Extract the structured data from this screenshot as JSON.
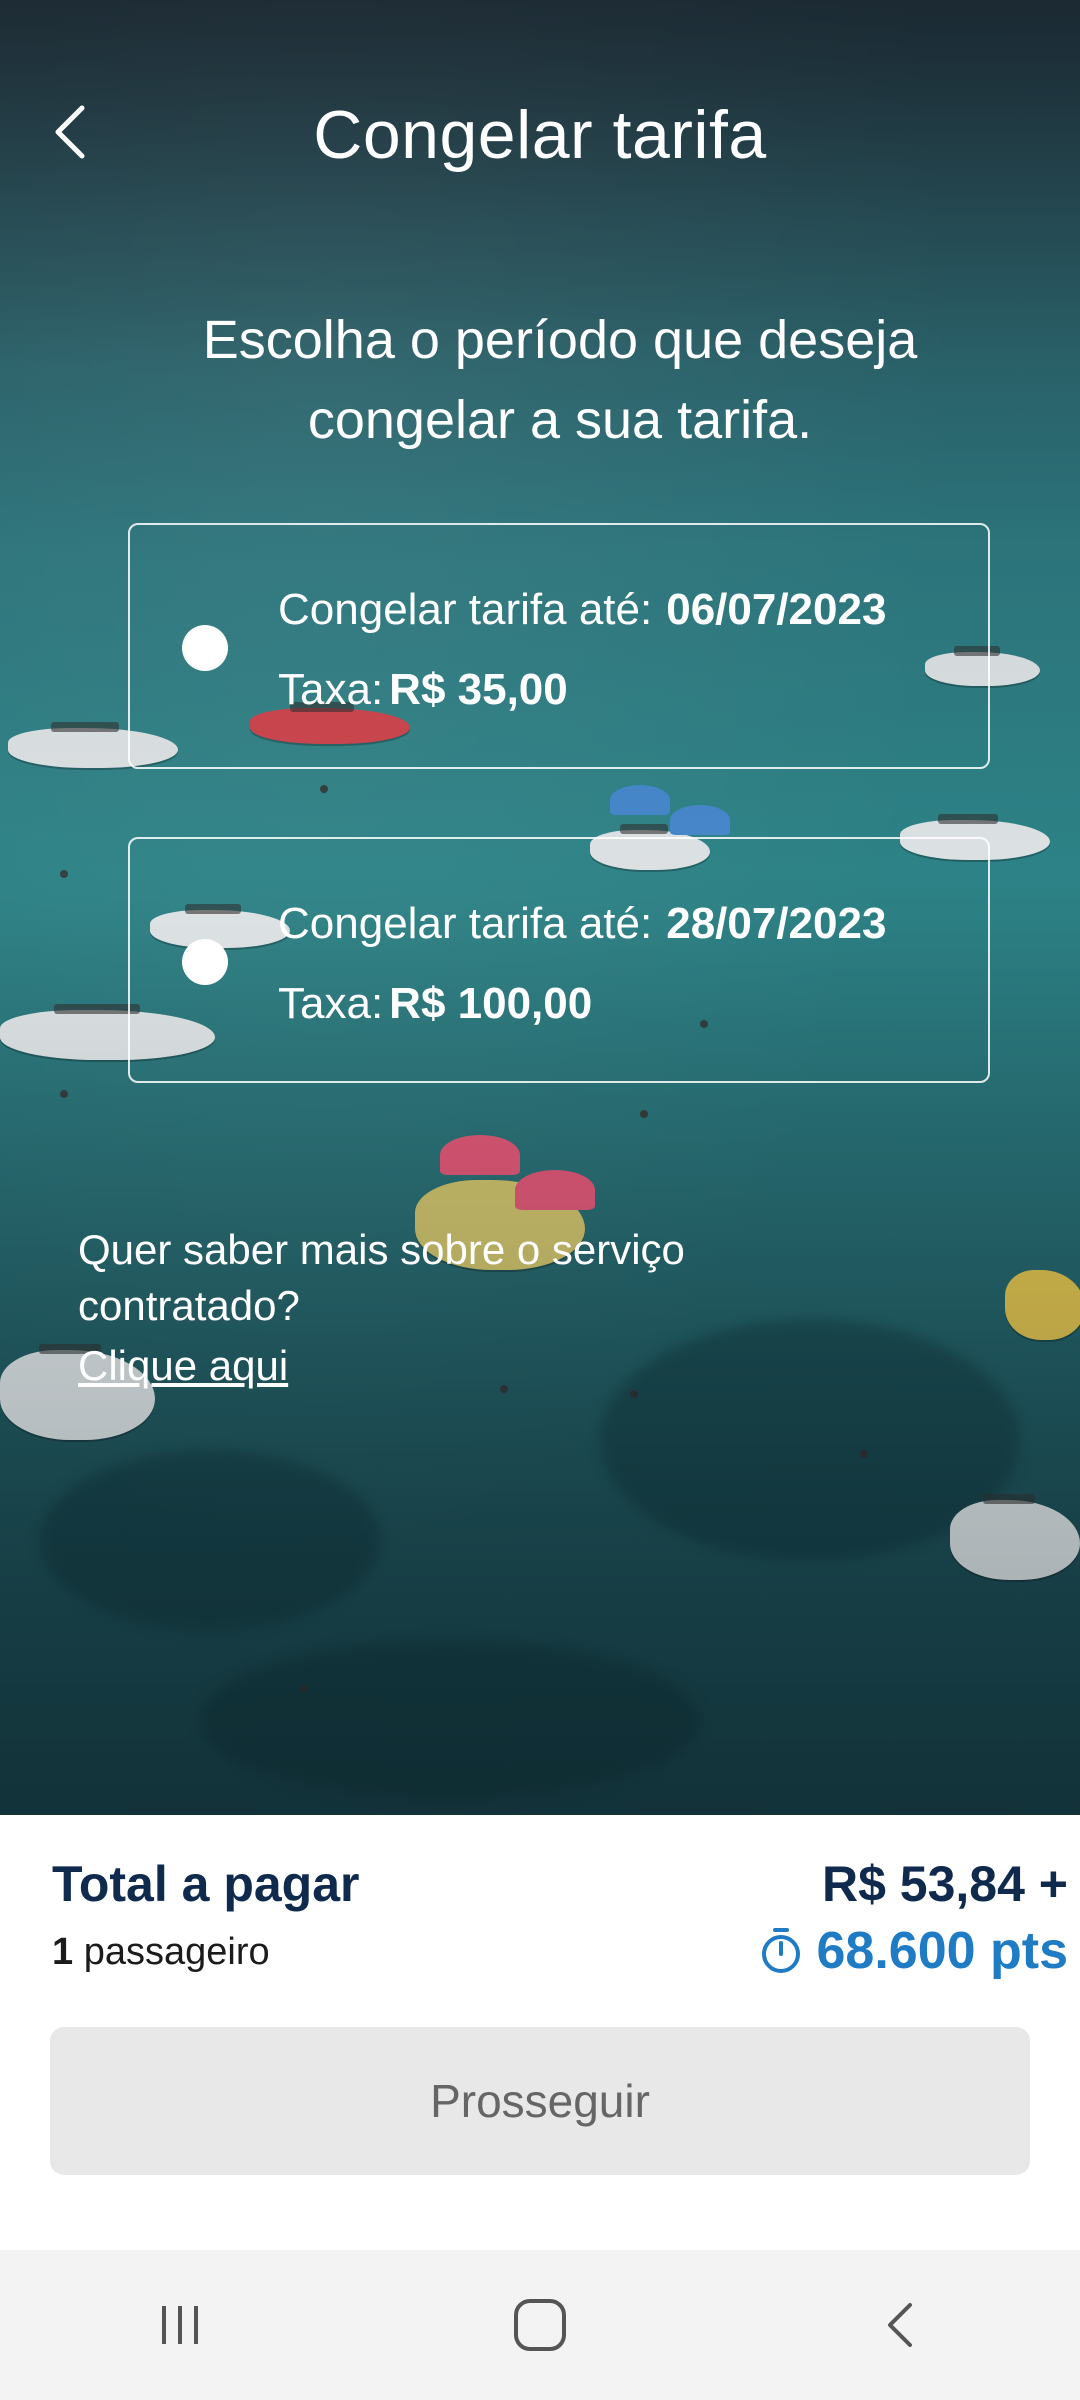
{
  "header": {
    "title": "Congelar tarifa",
    "back_icon": "chevron-left-icon"
  },
  "prompt": "Escolha o período que deseja congelar a sua tarifa.",
  "options": [
    {
      "label": "Congelar tarifa até:",
      "date": "06/07/2023",
      "fee_label": "Taxa:",
      "fee": "R$ 35,00",
      "selected": false
    },
    {
      "label": "Congelar tarifa até:",
      "date": "28/07/2023",
      "fee_label": "Taxa:",
      "fee": "R$ 100,00",
      "selected": false
    }
  ],
  "info": {
    "question": "Quer saber mais sobre o serviço contratado?",
    "link": "Clique aqui"
  },
  "footer": {
    "total_label": "Total a pagar",
    "passenger_count": "1",
    "passenger_label": "passageiro",
    "price": "R$ 53,84 +",
    "points": "68.600 pts",
    "points_icon": "stopwatch-icon",
    "proceed_label": "Prosseguir"
  },
  "colors": {
    "navy": "#0f2a4d",
    "points_blue": "#1e7bc4",
    "button_disabled": "#e8e8e8"
  },
  "system_nav": [
    "recents-icon",
    "home-icon",
    "back-icon"
  ]
}
